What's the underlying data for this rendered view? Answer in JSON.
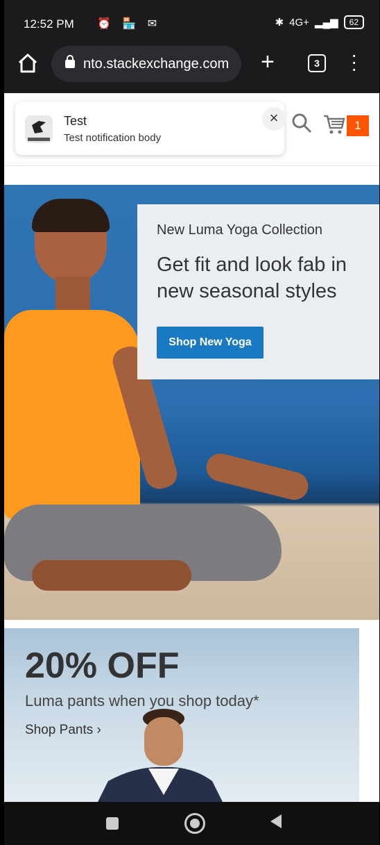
{
  "status_bar": {
    "time": "12:52 PM",
    "left_icons": "⏰ 🏪 ✉",
    "battery": "62",
    "network": "4G+"
  },
  "browser": {
    "url": "nto.stackexchange.com",
    "tab_count": "3"
  },
  "header": {
    "cart_count": "1"
  },
  "notification": {
    "title": "Test",
    "body": "Test notification body",
    "close": "×"
  },
  "hero": {
    "subtitle": "New Luma Yoga Collection",
    "headline": "Get fit and look fab in new seasonal styles",
    "button_label": "Shop New Yoga"
  },
  "promo2": {
    "headline": "20% OFF",
    "text": "Luma pants when you shop today*",
    "link": "Shop Pants ›"
  },
  "colors": {
    "accent_button": "#1979c3",
    "cart_badge": "#ff5501"
  }
}
